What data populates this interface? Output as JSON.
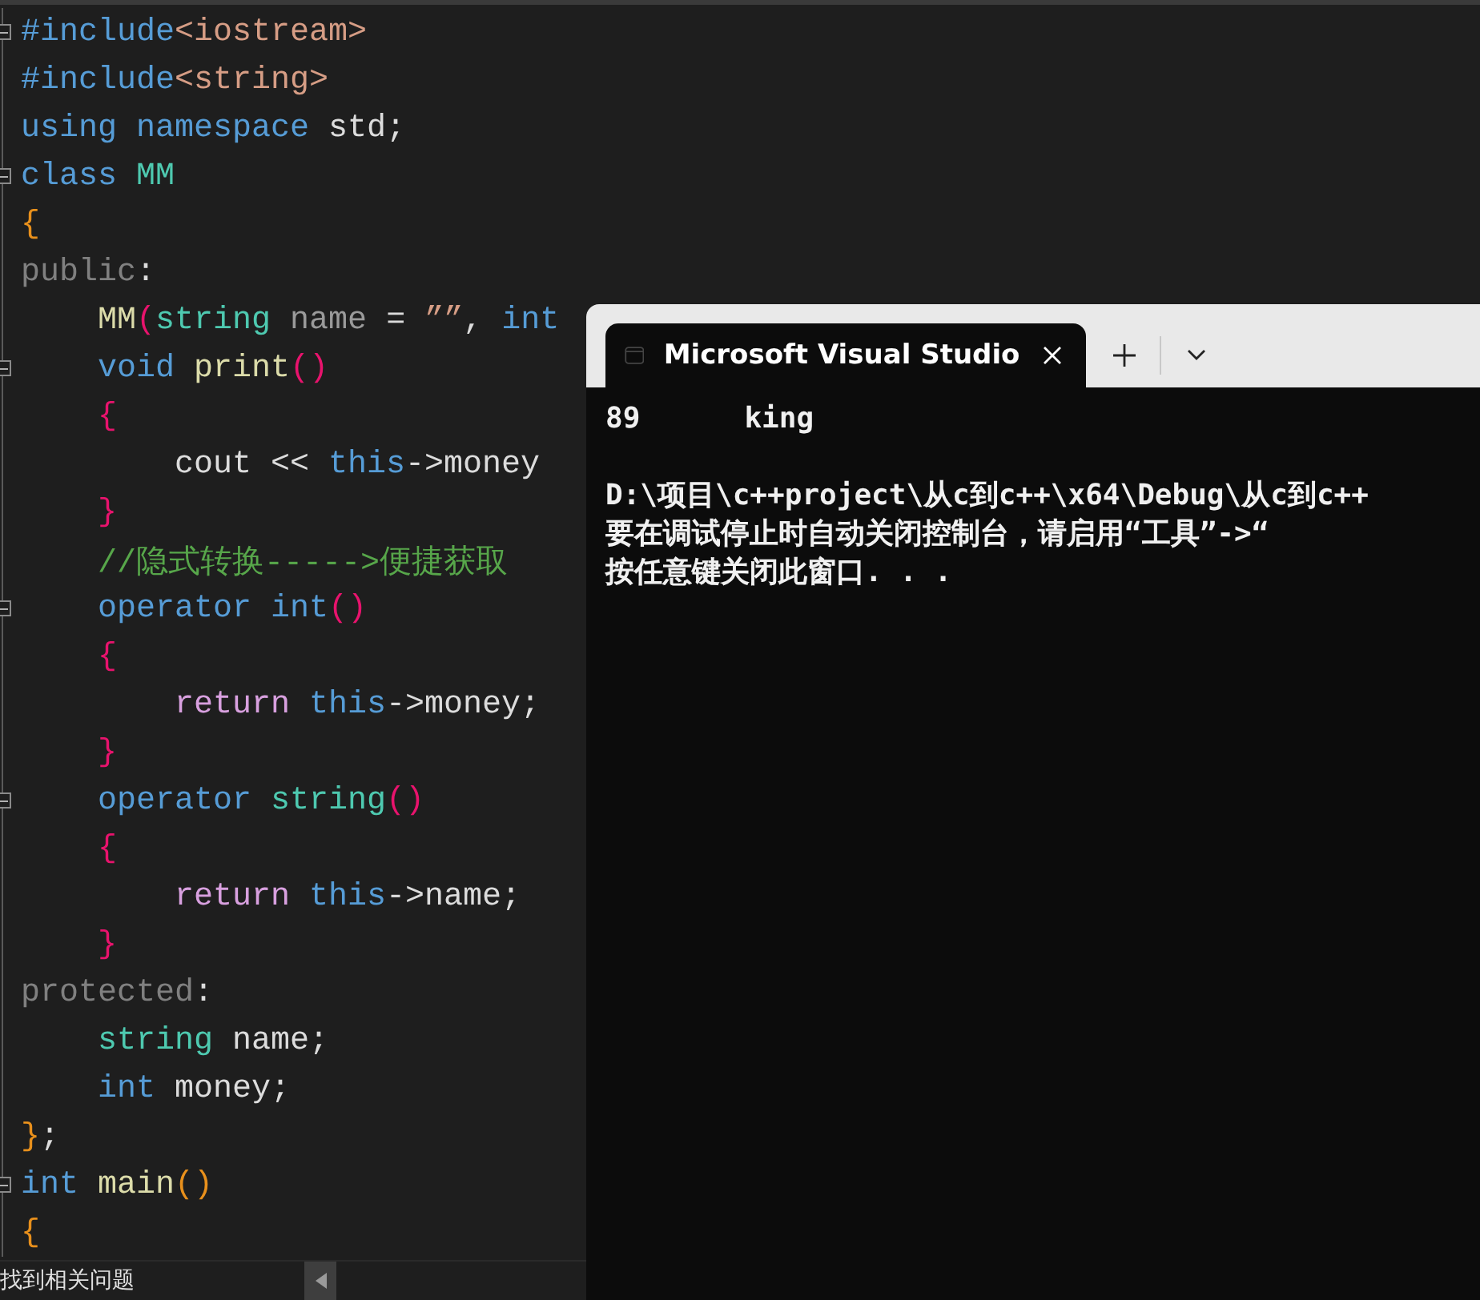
{
  "editor": {
    "lines": [
      {
        "fold": true,
        "tokens": [
          {
            "t": "#include",
            "kind": "kw"
          },
          {
            "t": "<iostream>",
            "kind": "str"
          }
        ]
      },
      {
        "fold": false,
        "tokens": [
          {
            "t": "#include",
            "kind": "kw"
          },
          {
            "t": "<string>",
            "kind": "str"
          }
        ]
      },
      {
        "fold": false,
        "tokens": [
          {
            "t": "using",
            "kind": "kw"
          },
          {
            "t": " namespace",
            "kind": "kw"
          },
          {
            "t": " std;",
            "kind": "plain"
          }
        ]
      },
      {
        "fold": true,
        "tokens": [
          {
            "t": "class",
            "kind": "kw"
          },
          {
            "t": " MM",
            "kind": "type"
          }
        ]
      },
      {
        "fold": false,
        "tokens": [
          {
            "t": "{",
            "kind": "br1"
          }
        ]
      },
      {
        "fold": false,
        "tokens": [
          {
            "t": "public",
            "kind": "access"
          },
          {
            "t": ":",
            "kind": "plain"
          }
        ]
      },
      {
        "fold": false,
        "tokens": [
          {
            "t": "    MM",
            "kind": "fn"
          },
          {
            "t": "(",
            "kind": "br2"
          },
          {
            "t": "string",
            "kind": "type"
          },
          {
            "t": " name",
            "kind": "param"
          },
          {
            "t": " = ",
            "kind": "plain"
          },
          {
            "t": "””",
            "kind": "str"
          },
          {
            "t": ", ",
            "kind": "plain"
          },
          {
            "t": "int",
            "kind": "kw"
          }
        ]
      },
      {
        "fold": true,
        "tokens": [
          {
            "t": "    void",
            "kind": "kw"
          },
          {
            "t": " print",
            "kind": "fn"
          },
          {
            "t": "()",
            "kind": "br2"
          }
        ]
      },
      {
        "fold": false,
        "tokens": [
          {
            "t": "    {",
            "kind": "br2"
          }
        ]
      },
      {
        "fold": false,
        "tokens": [
          {
            "t": "        cout << ",
            "kind": "plain"
          },
          {
            "t": "this",
            "kind": "kw"
          },
          {
            "t": "->money",
            "kind": "plain"
          }
        ]
      },
      {
        "fold": false,
        "tokens": [
          {
            "t": "    }",
            "kind": "br2"
          }
        ]
      },
      {
        "fold": false,
        "tokens": [
          {
            "t": "    //隐式转换----->便捷获取",
            "kind": "cmt"
          }
        ]
      },
      {
        "fold": true,
        "tokens": [
          {
            "t": "    operator",
            "kind": "kw"
          },
          {
            "t": " int",
            "kind": "kw"
          },
          {
            "t": "()",
            "kind": "br2"
          }
        ]
      },
      {
        "fold": false,
        "tokens": [
          {
            "t": "    {",
            "kind": "br2"
          }
        ]
      },
      {
        "fold": false,
        "tokens": [
          {
            "t": "        return",
            "kind": "ctrl"
          },
          {
            "t": " this",
            "kind": "kw"
          },
          {
            "t": "->money;",
            "kind": "plain"
          }
        ]
      },
      {
        "fold": false,
        "tokens": [
          {
            "t": "    }",
            "kind": "br2"
          }
        ]
      },
      {
        "fold": true,
        "tokens": [
          {
            "t": "    operator",
            "kind": "kw"
          },
          {
            "t": " string",
            "kind": "type"
          },
          {
            "t": "()",
            "kind": "br2"
          }
        ]
      },
      {
        "fold": false,
        "tokens": [
          {
            "t": "    {",
            "kind": "br2"
          }
        ]
      },
      {
        "fold": false,
        "tokens": [
          {
            "t": "        return",
            "kind": "ctrl"
          },
          {
            "t": " this",
            "kind": "kw"
          },
          {
            "t": "->name;",
            "kind": "plain"
          }
        ]
      },
      {
        "fold": false,
        "tokens": [
          {
            "t": "    }",
            "kind": "br2"
          }
        ]
      },
      {
        "fold": false,
        "tokens": [
          {
            "t": "protected",
            "kind": "access"
          },
          {
            "t": ":",
            "kind": "plain"
          }
        ]
      },
      {
        "fold": false,
        "tokens": [
          {
            "t": "    string",
            "kind": "type"
          },
          {
            "t": " name;",
            "kind": "plain"
          }
        ]
      },
      {
        "fold": false,
        "tokens": [
          {
            "t": "    int",
            "kind": "kw"
          },
          {
            "t": " money;",
            "kind": "plain"
          }
        ]
      },
      {
        "fold": false,
        "tokens": [
          {
            "t": "}",
            "kind": "br1"
          },
          {
            "t": ";",
            "kind": "plain"
          }
        ]
      },
      {
        "fold": true,
        "tokens": [
          {
            "t": "int",
            "kind": "kw"
          },
          {
            "t": " main",
            "kind": "fn"
          },
          {
            "t": "()",
            "kind": "br1"
          }
        ]
      },
      {
        "fold": false,
        "tokens": [
          {
            "t": "{",
            "kind": "br1"
          }
        ]
      }
    ]
  },
  "status_bar": {
    "message": "找到相关问题"
  },
  "console": {
    "tab": {
      "title": "Microsoft Visual Studio"
    },
    "output": [
      [
        "89      king"
      ],
      [
        "D:\\项目\\c++project\\从c到c++\\x64\\Debug\\从c到c++",
        "要在调试停止时自动关闭控制台，请启用“工具”->“",
        "按任意键关闭此窗口. . ."
      ]
    ]
  }
}
